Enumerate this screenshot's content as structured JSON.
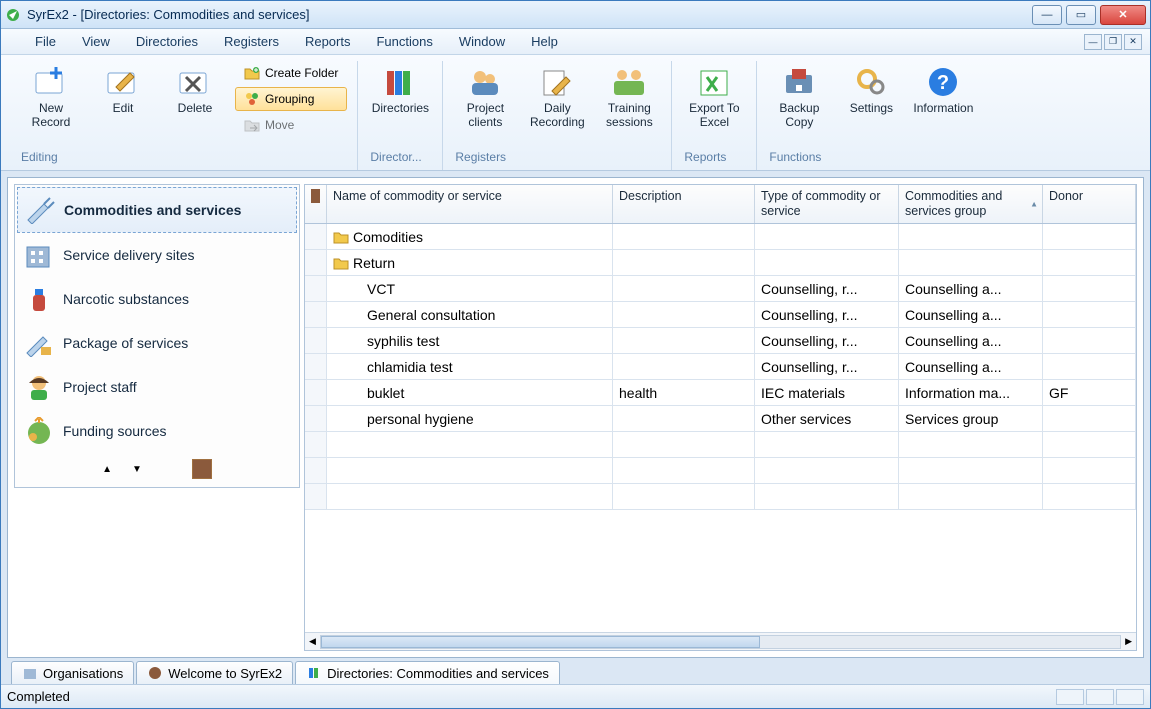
{
  "window": {
    "title": "SyrEx2 - [Directories: Commodities and services]"
  },
  "menu": {
    "file": "File",
    "view": "View",
    "directories": "Directories",
    "registers": "Registers",
    "reports": "Reports",
    "functions": "Functions",
    "window": "Window",
    "help": "Help"
  },
  "ribbon": {
    "editing": {
      "label": "Editing",
      "new_record": "New Record",
      "edit": "Edit",
      "delete": "Delete",
      "create_folder": "Create Folder",
      "grouping": "Grouping",
      "move": "Move"
    },
    "directories": {
      "label": "Director...",
      "directories": "Directories"
    },
    "registers": {
      "label": "Registers",
      "project_clients": "Project clients",
      "daily_recording": "Daily Recording",
      "training": "Training sessions"
    },
    "reports": {
      "label": "Reports",
      "export_excel": "Export To Excel"
    },
    "functions": {
      "label": "Functions",
      "backup": "Backup Copy",
      "settings": "Settings",
      "information": "Information"
    }
  },
  "sidebar": {
    "items": [
      {
        "label": "Commodities and services"
      },
      {
        "label": "Service delivery sites"
      },
      {
        "label": "Narcotic substances"
      },
      {
        "label": "Package of services"
      },
      {
        "label": "Project staff"
      },
      {
        "label": "Funding sources"
      }
    ]
  },
  "grid": {
    "columns": {
      "name": "Name of commodity or service",
      "desc": "Description",
      "type": "Type of commodity or service",
      "group": "Commodities and services group",
      "donor": "Donor"
    },
    "rows": [
      {
        "kind": "folder",
        "name": "Comodities",
        "desc": "",
        "type": "",
        "group": "",
        "donor": ""
      },
      {
        "kind": "folder",
        "name": "Return",
        "desc": "",
        "type": "",
        "group": "",
        "donor": ""
      },
      {
        "kind": "item",
        "indent": 1,
        "name": "VCT",
        "desc": "",
        "type": "Counselling, r...",
        "group": "Counselling a...",
        "donor": ""
      },
      {
        "kind": "item",
        "indent": 1,
        "name": "General consultation",
        "desc": "",
        "type": "Counselling, r...",
        "group": "Counselling a...",
        "donor": ""
      },
      {
        "kind": "item",
        "indent": 1,
        "name": "syphilis test",
        "desc": "",
        "type": "Counselling, r...",
        "group": "Counselling a...",
        "donor": ""
      },
      {
        "kind": "item",
        "indent": 1,
        "name": "chlamidia test",
        "desc": "",
        "type": "Counselling, r...",
        "group": "Counselling a...",
        "donor": ""
      },
      {
        "kind": "item",
        "indent": 1,
        "name": "buklet",
        "desc": "health",
        "type": "IEC materials",
        "group": "Information ma...",
        "donor": "GF"
      },
      {
        "kind": "item",
        "indent": 1,
        "name": "personal hygiene",
        "desc": "",
        "type": "Other services",
        "group": "Services group",
        "donor": ""
      }
    ]
  },
  "tabs": [
    {
      "label": "Organisations"
    },
    {
      "label": "Welcome to SyrEx2"
    },
    {
      "label": "Directories: Commodities and services"
    }
  ],
  "status": {
    "text": "Completed"
  }
}
